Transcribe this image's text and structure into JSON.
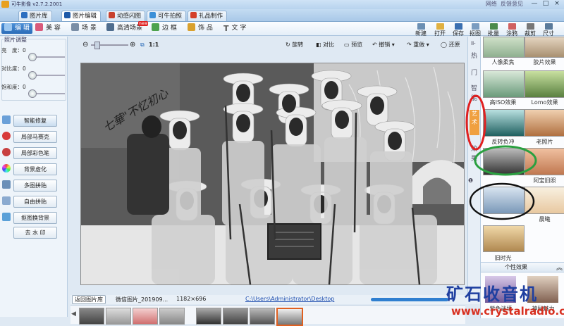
{
  "window": {
    "title": "可牛影像 v2.7.2.2001",
    "links": [
      "网络",
      "反馈意见"
    ],
    "controls": [
      "—",
      "□",
      "×"
    ]
  },
  "tabs": [
    {
      "label": "图片库",
      "color": "#2d6fc0"
    },
    {
      "label": "图片编辑",
      "color": "#1e5aa8",
      "active": true
    },
    {
      "label": "动感闪图",
      "color": "#c8412e"
    },
    {
      "label": "可牛拍照",
      "color": "#3a8fd8"
    },
    {
      "label": "礼品制作",
      "color": "#d4402a"
    }
  ],
  "toolbar": {
    "items": [
      {
        "label": "编 辑",
        "color": "#3f86d0",
        "active": true
      },
      {
        "label": "美 容",
        "color": "#d95a7b"
      },
      {
        "label": "场 景",
        "color": "#7a8ea6"
      },
      {
        "label": "高清场景",
        "color": "#4f6d8e",
        "badge": "new"
      },
      {
        "label": "边 框",
        "color": "#4da24d"
      },
      {
        "label": "饰 品",
        "color": "#d9a12e"
      },
      {
        "label": "文 字",
        "color": "#555555"
      }
    ],
    "right": [
      "新建",
      "打开",
      "保存",
      "抠图",
      "批量",
      "涂鸦",
      "裁剪",
      "尺寸"
    ]
  },
  "left_panel": {
    "header": "照片调整",
    "sliders": [
      {
        "label": "亮　度：0",
        "value": 0
      },
      {
        "label": "对比度：0",
        "value": 0
      },
      {
        "label": "饱和度：0",
        "value": 0
      }
    ],
    "buttons": [
      {
        "label": "智能修复",
        "icon_color": "#6aa0d8",
        "selected": true
      },
      {
        "label": "局部马赛克",
        "icon_color": "#d83a3a"
      },
      {
        "label": "局部彩色笔",
        "icon_color": "#c84040"
      },
      {
        "label": "背景虚化",
        "icon_color": "#3a9bd0"
      },
      {
        "label": "多图拼贴",
        "icon_color": "#6a8fb8"
      },
      {
        "label": "自由拼贴",
        "icon_color": "#8aaad0"
      },
      {
        "label": "抠图换背景",
        "icon_color": "#5aa0d8"
      },
      {
        "label": "去 水 印",
        "icon_color": "#99a"
      }
    ]
  },
  "canvas_bar": {
    "zoom_label": "1:1",
    "zoom_level": 0.15,
    "buttons": [
      "旋转",
      "对比",
      "预览",
      "撤销",
      "重做",
      "还原"
    ]
  },
  "photo": {
    "handwriting": "七華\"不忆初心"
  },
  "side_strip": {
    "chars": [
      "热",
      "门",
      "智",
      "能",
      "艺",
      "术",
      "效",
      "果"
    ]
  },
  "right_panel": {
    "effects": [
      [
        "人像柔焦",
        "胶片效果"
      ],
      [
        "高ISO效果",
        "Lomo效果"
      ],
      [
        "反转负冲",
        "老照片"
      ],
      [
        "",
        "阿宝旧照"
      ],
      [
        "",
        "晨曦"
      ],
      [
        "旧时光",
        ""
      ]
    ],
    "section_label": "个性效果",
    "bottom_labels": [
      "紫色迷境",
      "神秘魅力"
    ]
  },
  "status": {
    "back_button": "返回图片库",
    "filename": "微信图片_201909...",
    "dimensions": "1182×696",
    "path": "C:\\Users\\Administrator\\Desktop"
  },
  "watermark": {
    "cn": "矿石收音机",
    "url": "www.crystalradio.cn"
  },
  "annotation_colors": {
    "red": "#e02020",
    "green": "#2aa040",
    "black": "#111111"
  }
}
